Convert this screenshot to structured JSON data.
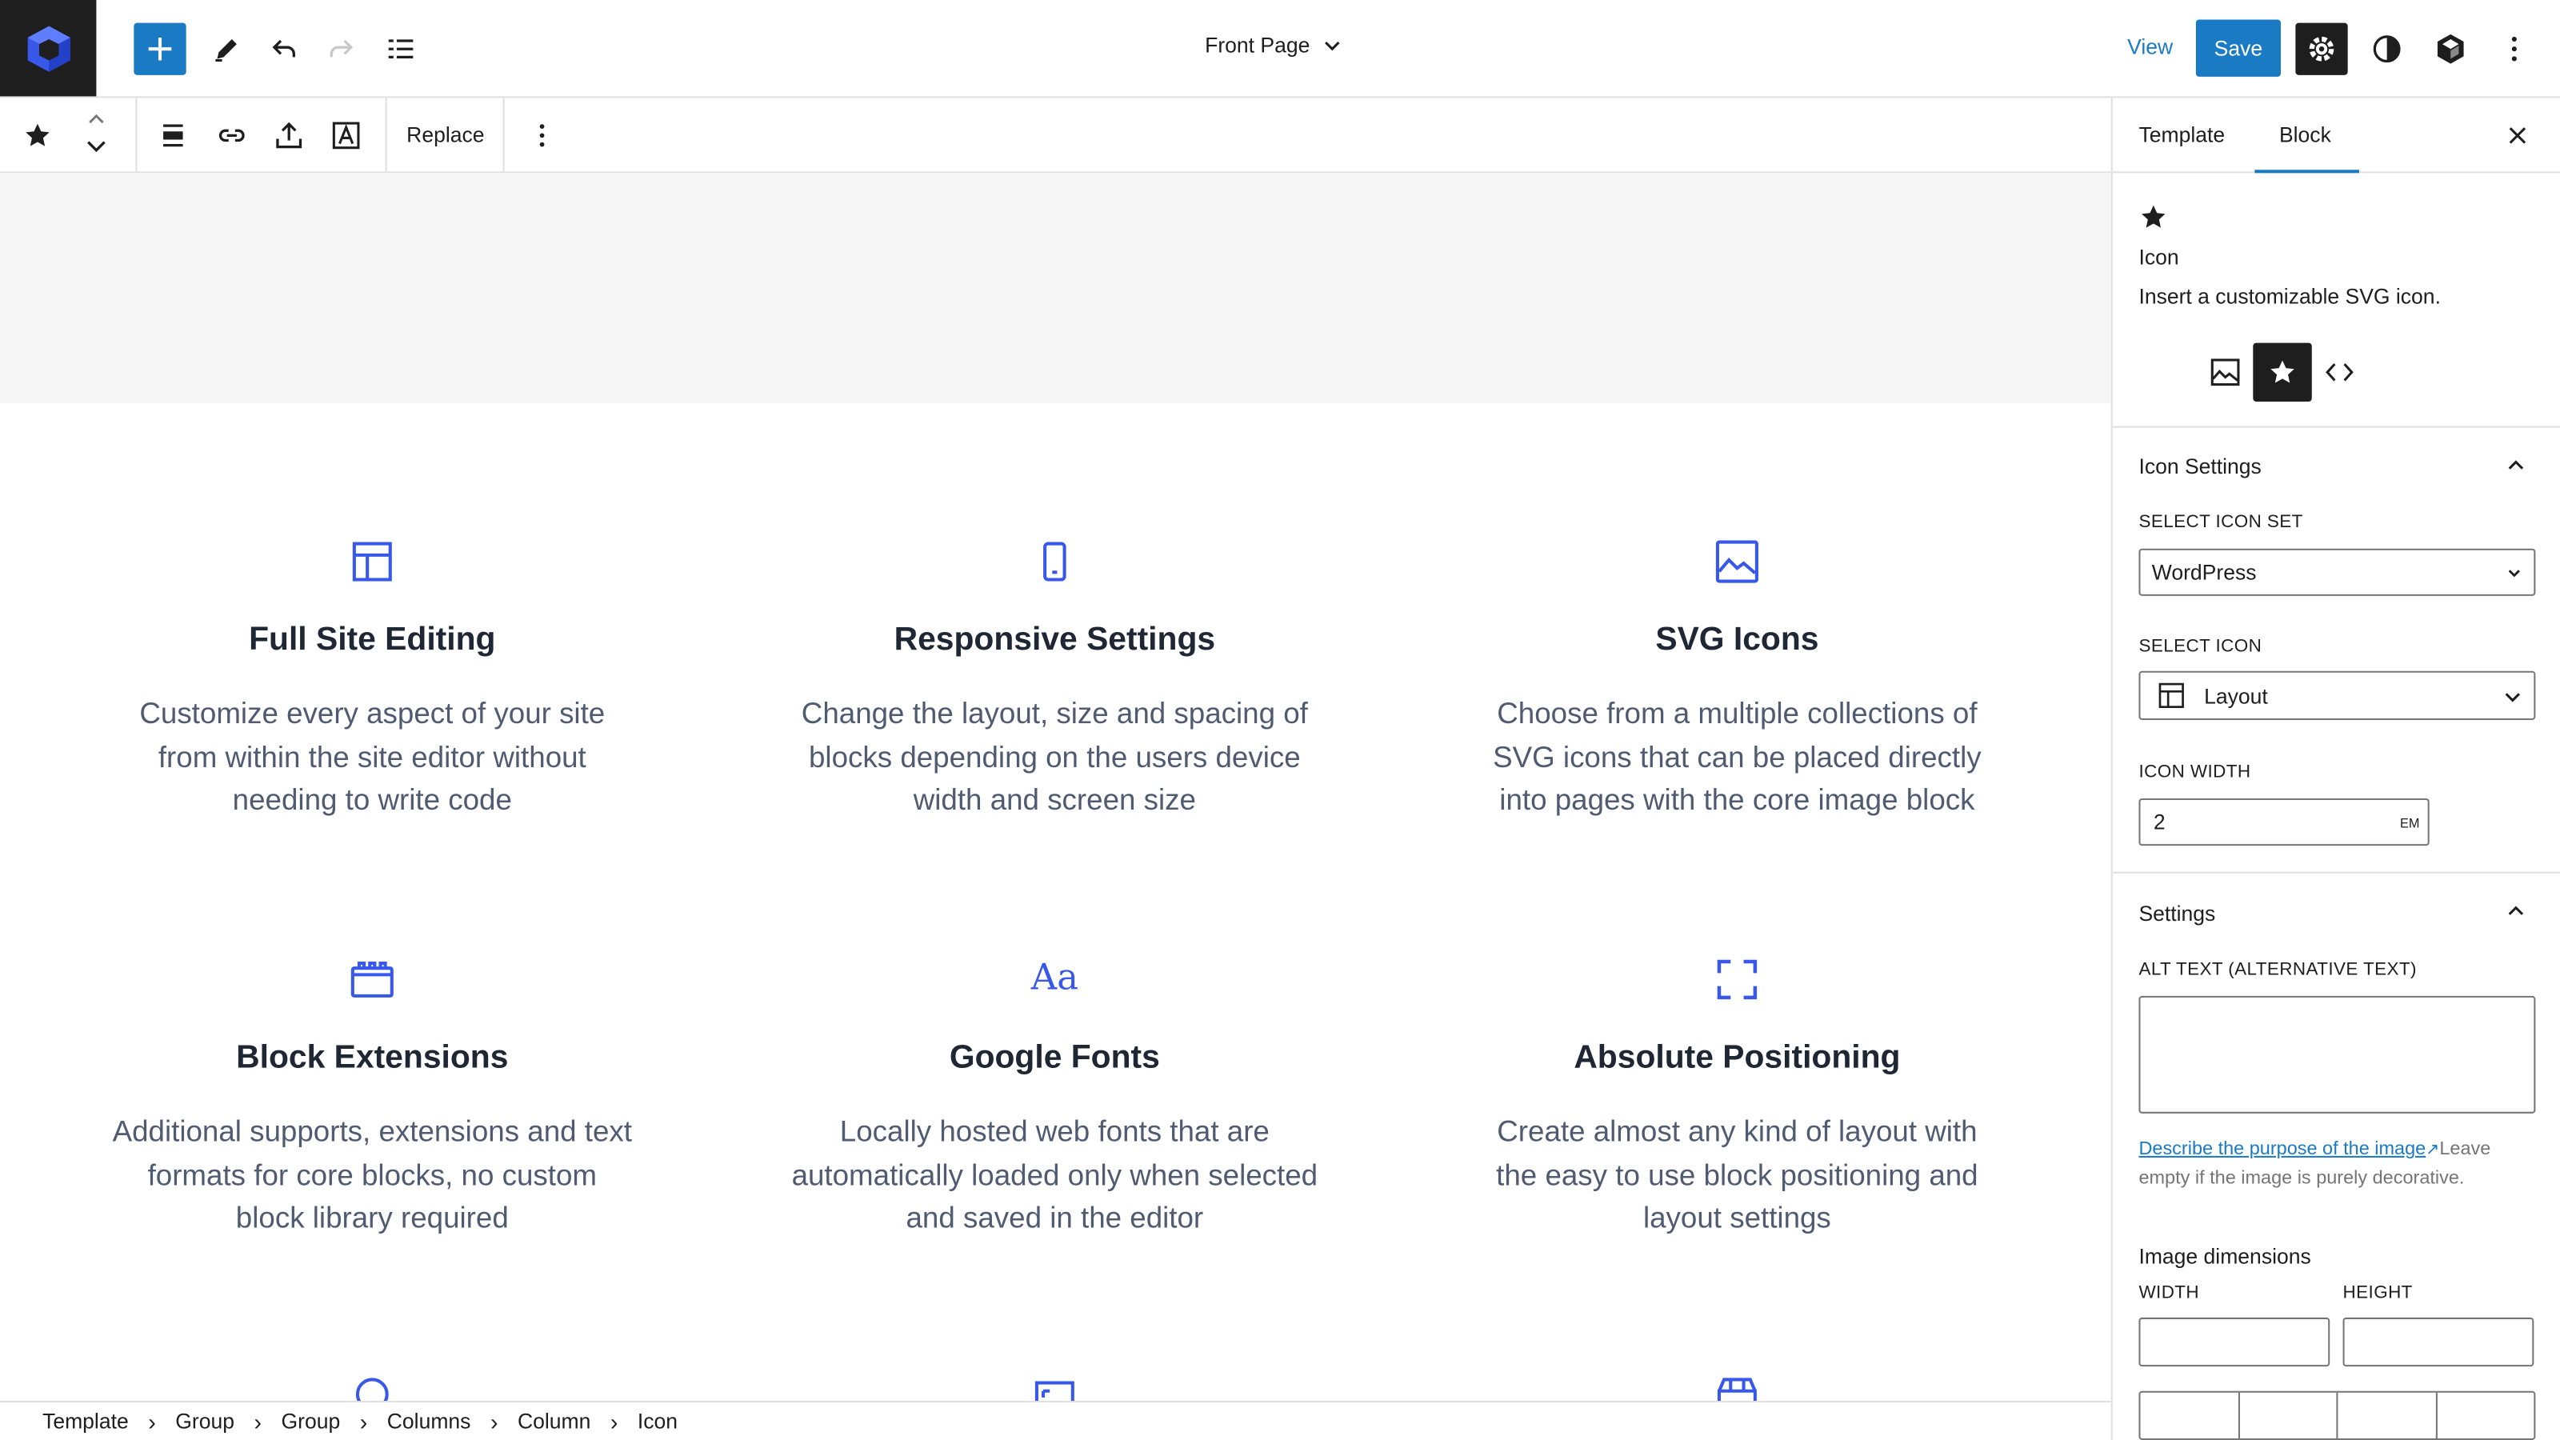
{
  "topbar": {
    "document_title": "Front Page",
    "view_label": "View",
    "save_label": "Save"
  },
  "block_toolbar": {
    "replace_label": "Replace"
  },
  "features": [
    {
      "icon": "layout-icon",
      "title": "Full Site Editing",
      "lines": [
        "Customize every aspect of your site",
        "from within the site editor without",
        "needing to write code"
      ]
    },
    {
      "icon": "mobile-icon",
      "title": "Responsive Settings",
      "lines": [
        "Change the layout, size and spacing of",
        "blocks depending on the users device",
        "width and screen size"
      ]
    },
    {
      "icon": "image-icon",
      "title": "SVG Icons",
      "lines": [
        "Choose from a multiple collections of",
        "SVG icons that can be placed directly",
        "into pages with the core image block"
      ]
    },
    {
      "icon": "block-extensions-icon",
      "title": "Block Extensions",
      "lines": [
        "Additional supports, extensions and text",
        "formats for core blocks, no custom",
        "block library required"
      ]
    },
    {
      "icon": "typography-icon",
      "title": "Google Fonts",
      "glyph": "Aa",
      "lines": [
        "Locally hosted web fonts that are",
        "automatically loaded only when selected",
        "and saved in the editor"
      ]
    },
    {
      "icon": "fullscreen-icon",
      "title": "Absolute Positioning",
      "lines": [
        "Create almost any kind of layout with",
        "the easy to use block positioning and",
        "layout settings"
      ]
    }
  ],
  "breadcrumb": [
    "Template",
    "Group",
    "Group",
    "Columns",
    "Column",
    "Icon"
  ],
  "sidebar": {
    "tabs": [
      "Template",
      "Block"
    ],
    "active_tab": "Block",
    "block": {
      "name": "Icon",
      "description": "Insert a customizable SVG icon."
    },
    "icon_settings": {
      "title": "Icon Settings",
      "icon_set_label": "SELECT ICON SET",
      "icon_set_value": "WordPress",
      "icon_label": "SELECT ICON",
      "icon_value": "Layout",
      "width_label": "ICON WIDTH",
      "width_value": "2",
      "width_unit": "EM"
    },
    "settings": {
      "title": "Settings",
      "alt_label": "ALT TEXT (ALTERNATIVE TEXT)",
      "alt_value": "",
      "help_link": "Describe the purpose of the image",
      "help_text": "Leave empty if the image is purely decorative.",
      "dimensions_label": "Image dimensions",
      "width_label": "WIDTH",
      "height_label": "HEIGHT"
    }
  },
  "colors": {
    "accent": "#1a7ac4",
    "feature_icon": "#3858e9",
    "heading": "#1e2733",
    "body": "#505b72"
  }
}
